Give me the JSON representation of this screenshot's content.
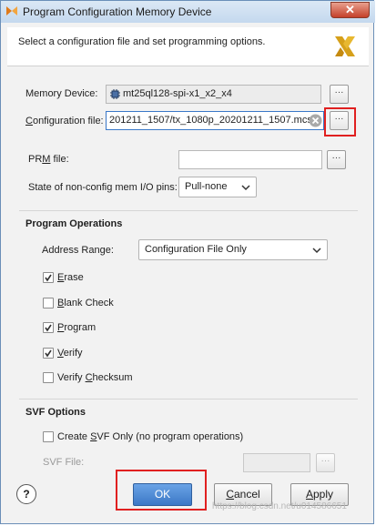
{
  "window": {
    "title": "Program Configuration Memory Device",
    "close_glyph": "✕",
    "header_text": "Select a configuration file and set programming options."
  },
  "memory_device": {
    "label": "Memory Device:",
    "value": "mt25ql128-spi-x1_x2_x4"
  },
  "configuration_file": {
    "label": "Configuration file:",
    "value": "201211_1507/tx_1080p_20201211_1507.mcs"
  },
  "prm_file": {
    "label": "PRM file:",
    "value": ""
  },
  "non_config_pins": {
    "label": "State of non-config mem I/O pins:",
    "value": "Pull-none"
  },
  "browse_label": "···",
  "program_operations": {
    "title": "Program Operations",
    "address_range_label": "Address Range:",
    "address_range_value": "Configuration File Only",
    "options": [
      {
        "label": "Erase",
        "checked": true
      },
      {
        "label": "Blank Check",
        "checked": false
      },
      {
        "label": "Program",
        "checked": true
      },
      {
        "label": "Verify",
        "checked": true
      },
      {
        "label": "Verify Checksum",
        "checked": false
      }
    ]
  },
  "svf_options": {
    "title": "SVF Options",
    "create_svf_label": "Create SVF Only (no program operations)",
    "create_svf_checked": false,
    "svf_file_label": "SVF File:",
    "svf_file_value": ""
  },
  "buttons": {
    "help": "?",
    "ok": "OK",
    "cancel": "Cancel",
    "apply": "Apply"
  },
  "watermark": "https://blog.csdn.net/u014586651",
  "colors": {
    "accent": "#3c78c6",
    "highlight": "#e02020",
    "title_bar": "#c4d8ee"
  }
}
